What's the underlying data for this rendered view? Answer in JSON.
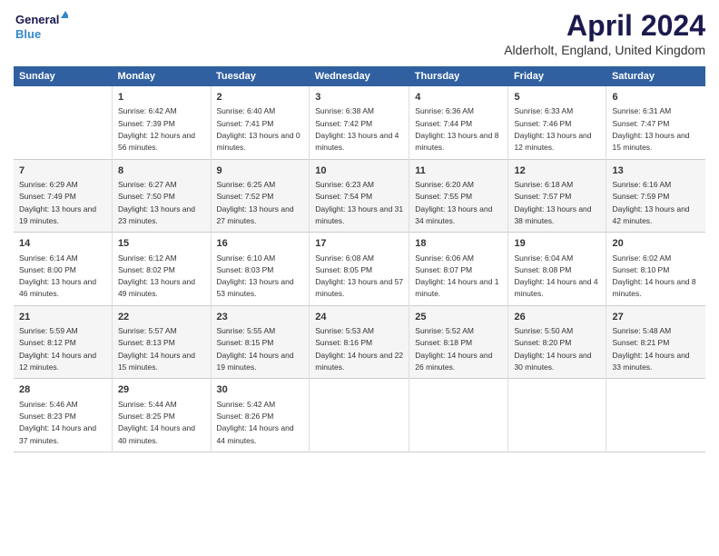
{
  "header": {
    "logo_line1": "General",
    "logo_line2": "Blue",
    "month": "April 2024",
    "location": "Alderholt, England, United Kingdom"
  },
  "weekdays": [
    "Sunday",
    "Monday",
    "Tuesday",
    "Wednesday",
    "Thursday",
    "Friday",
    "Saturday"
  ],
  "weeks": [
    [
      {
        "day": "",
        "sunrise": "",
        "sunset": "",
        "daylight": ""
      },
      {
        "day": "1",
        "sunrise": "Sunrise: 6:42 AM",
        "sunset": "Sunset: 7:39 PM",
        "daylight": "Daylight: 12 hours and 56 minutes."
      },
      {
        "day": "2",
        "sunrise": "Sunrise: 6:40 AM",
        "sunset": "Sunset: 7:41 PM",
        "daylight": "Daylight: 13 hours and 0 minutes."
      },
      {
        "day": "3",
        "sunrise": "Sunrise: 6:38 AM",
        "sunset": "Sunset: 7:42 PM",
        "daylight": "Daylight: 13 hours and 4 minutes."
      },
      {
        "day": "4",
        "sunrise": "Sunrise: 6:36 AM",
        "sunset": "Sunset: 7:44 PM",
        "daylight": "Daylight: 13 hours and 8 minutes."
      },
      {
        "day": "5",
        "sunrise": "Sunrise: 6:33 AM",
        "sunset": "Sunset: 7:46 PM",
        "daylight": "Daylight: 13 hours and 12 minutes."
      },
      {
        "day": "6",
        "sunrise": "Sunrise: 6:31 AM",
        "sunset": "Sunset: 7:47 PM",
        "daylight": "Daylight: 13 hours and 15 minutes."
      }
    ],
    [
      {
        "day": "7",
        "sunrise": "Sunrise: 6:29 AM",
        "sunset": "Sunset: 7:49 PM",
        "daylight": "Daylight: 13 hours and 19 minutes."
      },
      {
        "day": "8",
        "sunrise": "Sunrise: 6:27 AM",
        "sunset": "Sunset: 7:50 PM",
        "daylight": "Daylight: 13 hours and 23 minutes."
      },
      {
        "day": "9",
        "sunrise": "Sunrise: 6:25 AM",
        "sunset": "Sunset: 7:52 PM",
        "daylight": "Daylight: 13 hours and 27 minutes."
      },
      {
        "day": "10",
        "sunrise": "Sunrise: 6:23 AM",
        "sunset": "Sunset: 7:54 PM",
        "daylight": "Daylight: 13 hours and 31 minutes."
      },
      {
        "day": "11",
        "sunrise": "Sunrise: 6:20 AM",
        "sunset": "Sunset: 7:55 PM",
        "daylight": "Daylight: 13 hours and 34 minutes."
      },
      {
        "day": "12",
        "sunrise": "Sunrise: 6:18 AM",
        "sunset": "Sunset: 7:57 PM",
        "daylight": "Daylight: 13 hours and 38 minutes."
      },
      {
        "day": "13",
        "sunrise": "Sunrise: 6:16 AM",
        "sunset": "Sunset: 7:59 PM",
        "daylight": "Daylight: 13 hours and 42 minutes."
      }
    ],
    [
      {
        "day": "14",
        "sunrise": "Sunrise: 6:14 AM",
        "sunset": "Sunset: 8:00 PM",
        "daylight": "Daylight: 13 hours and 46 minutes."
      },
      {
        "day": "15",
        "sunrise": "Sunrise: 6:12 AM",
        "sunset": "Sunset: 8:02 PM",
        "daylight": "Daylight: 13 hours and 49 minutes."
      },
      {
        "day": "16",
        "sunrise": "Sunrise: 6:10 AM",
        "sunset": "Sunset: 8:03 PM",
        "daylight": "Daylight: 13 hours and 53 minutes."
      },
      {
        "day": "17",
        "sunrise": "Sunrise: 6:08 AM",
        "sunset": "Sunset: 8:05 PM",
        "daylight": "Daylight: 13 hours and 57 minutes."
      },
      {
        "day": "18",
        "sunrise": "Sunrise: 6:06 AM",
        "sunset": "Sunset: 8:07 PM",
        "daylight": "Daylight: 14 hours and 1 minute."
      },
      {
        "day": "19",
        "sunrise": "Sunrise: 6:04 AM",
        "sunset": "Sunset: 8:08 PM",
        "daylight": "Daylight: 14 hours and 4 minutes."
      },
      {
        "day": "20",
        "sunrise": "Sunrise: 6:02 AM",
        "sunset": "Sunset: 8:10 PM",
        "daylight": "Daylight: 14 hours and 8 minutes."
      }
    ],
    [
      {
        "day": "21",
        "sunrise": "Sunrise: 5:59 AM",
        "sunset": "Sunset: 8:12 PM",
        "daylight": "Daylight: 14 hours and 12 minutes."
      },
      {
        "day": "22",
        "sunrise": "Sunrise: 5:57 AM",
        "sunset": "Sunset: 8:13 PM",
        "daylight": "Daylight: 14 hours and 15 minutes."
      },
      {
        "day": "23",
        "sunrise": "Sunrise: 5:55 AM",
        "sunset": "Sunset: 8:15 PM",
        "daylight": "Daylight: 14 hours and 19 minutes."
      },
      {
        "day": "24",
        "sunrise": "Sunrise: 5:53 AM",
        "sunset": "Sunset: 8:16 PM",
        "daylight": "Daylight: 14 hours and 22 minutes."
      },
      {
        "day": "25",
        "sunrise": "Sunrise: 5:52 AM",
        "sunset": "Sunset: 8:18 PM",
        "daylight": "Daylight: 14 hours and 26 minutes."
      },
      {
        "day": "26",
        "sunrise": "Sunrise: 5:50 AM",
        "sunset": "Sunset: 8:20 PM",
        "daylight": "Daylight: 14 hours and 30 minutes."
      },
      {
        "day": "27",
        "sunrise": "Sunrise: 5:48 AM",
        "sunset": "Sunset: 8:21 PM",
        "daylight": "Daylight: 14 hours and 33 minutes."
      }
    ],
    [
      {
        "day": "28",
        "sunrise": "Sunrise: 5:46 AM",
        "sunset": "Sunset: 8:23 PM",
        "daylight": "Daylight: 14 hours and 37 minutes."
      },
      {
        "day": "29",
        "sunrise": "Sunrise: 5:44 AM",
        "sunset": "Sunset: 8:25 PM",
        "daylight": "Daylight: 14 hours and 40 minutes."
      },
      {
        "day": "30",
        "sunrise": "Sunrise: 5:42 AM",
        "sunset": "Sunset: 8:26 PM",
        "daylight": "Daylight: 14 hours and 44 minutes."
      },
      {
        "day": "",
        "sunrise": "",
        "sunset": "",
        "daylight": ""
      },
      {
        "day": "",
        "sunrise": "",
        "sunset": "",
        "daylight": ""
      },
      {
        "day": "",
        "sunrise": "",
        "sunset": "",
        "daylight": ""
      },
      {
        "day": "",
        "sunrise": "",
        "sunset": "",
        "daylight": ""
      }
    ]
  ]
}
